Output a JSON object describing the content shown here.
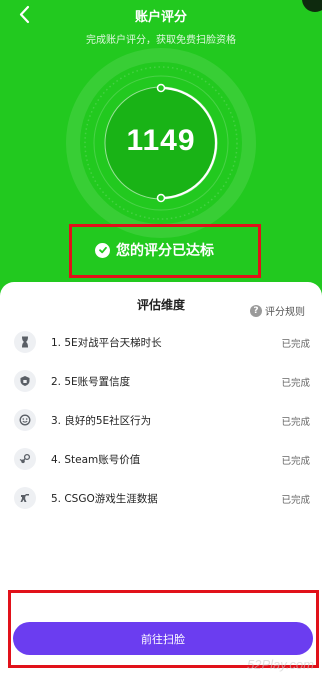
{
  "header": {
    "title": "账户评分",
    "subtitle": "完成账户评分，获取免费扫脸资格"
  },
  "score": {
    "value": "1149",
    "status_text": "您的评分已达标"
  },
  "panel": {
    "title": "评估维度",
    "rules_label": "评分规则",
    "rules_icon_text": "?",
    "items": [
      {
        "label": "1. 5E对战平台天梯时长",
        "status": "已完成",
        "icon": "hourglass-icon"
      },
      {
        "label": "2. 5E账号置信度",
        "status": "已完成",
        "icon": "shield-icon"
      },
      {
        "label": "3. 良好的5E社区行为",
        "status": "已完成",
        "icon": "smiley-icon"
      },
      {
        "label": "4. Steam账号价值",
        "status": "已完成",
        "icon": "steam-icon"
      },
      {
        "label": "5. CSGO游戏生涯数据",
        "status": "已完成",
        "icon": "csgo-icon"
      }
    ]
  },
  "cta": {
    "label": "前往扫脸"
  },
  "watermark": "52Play.com",
  "colors": {
    "hero_green": "#22c91f",
    "button_purple": "#6b3df0",
    "highlight_red": "#e1111a"
  }
}
